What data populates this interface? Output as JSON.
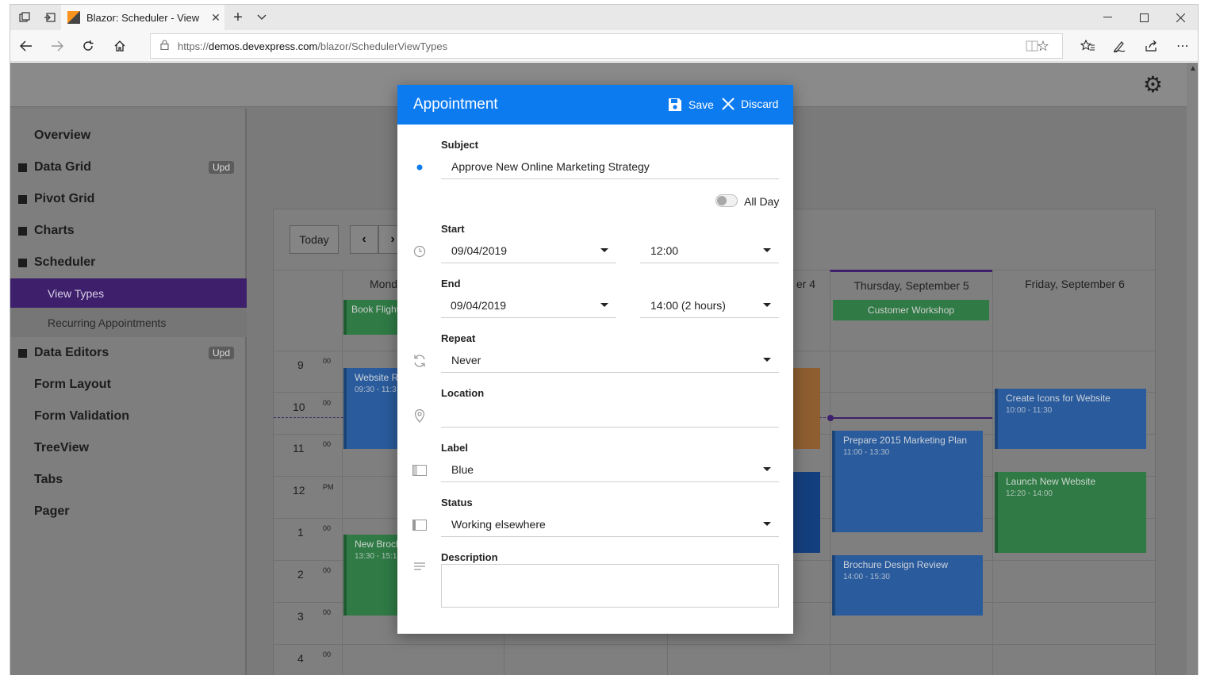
{
  "browser": {
    "tab_title": "Blazor: Scheduler - View",
    "url_prefix": "https://",
    "url_host": "demos.devexpress.com",
    "url_path": "/blazor/SchedulerViewTypes"
  },
  "sidebar": {
    "items": [
      {
        "label": "Overview",
        "bullet": false,
        "badge": ""
      },
      {
        "label": "Data Grid",
        "bullet": true,
        "badge": "Upd"
      },
      {
        "label": "Pivot Grid",
        "bullet": true,
        "badge": ""
      },
      {
        "label": "Charts",
        "bullet": true,
        "badge": ""
      },
      {
        "label": "Scheduler",
        "bullet": true,
        "badge": ""
      }
    ],
    "subitems": [
      {
        "label": "View Types",
        "active": true
      },
      {
        "label": "Recurring Appointments",
        "active": false
      }
    ],
    "items_after": [
      {
        "label": "Data Editors",
        "bullet": true,
        "badge": "Upd"
      },
      {
        "label": "Form Layout",
        "bullet": false,
        "badge": ""
      },
      {
        "label": "Form Validation",
        "bullet": false,
        "badge": ""
      },
      {
        "label": "TreeView",
        "bullet": false,
        "badge": ""
      },
      {
        "label": "Tabs",
        "bullet": false,
        "badge": ""
      },
      {
        "label": "Pager",
        "bullet": false,
        "badge": ""
      }
    ]
  },
  "scheduler": {
    "today_label": "Today",
    "days": [
      "Mond",
      "er 4",
      "Thursday, September 5",
      "Friday, September 6"
    ],
    "hours": [
      {
        "h": "9",
        "m": "00"
      },
      {
        "h": "10",
        "m": "00"
      },
      {
        "h": "11",
        "m": "00"
      },
      {
        "h": "12",
        "m": "PM"
      },
      {
        "h": "1",
        "m": "00"
      },
      {
        "h": "2",
        "m": "00"
      },
      {
        "h": "3",
        "m": "00"
      },
      {
        "h": "4",
        "m": "00"
      }
    ],
    "allday": {
      "mon": "Book Flight",
      "thu": "Customer Workshop"
    },
    "appointments": {
      "mon1": {
        "title": "Website Re",
        "time": "09:30 - 11:3"
      },
      "mon2": {
        "title": "New Broch",
        "time": "13:30 - 15:1"
      },
      "thu1": {
        "title": "Prepare 2015 Marketing Plan",
        "time": "11:00 - 13:30"
      },
      "thu2": {
        "title": "Brochure Design Review",
        "time": "14:00 - 15:30"
      },
      "fri1": {
        "title": "Create Icons for Website",
        "time": "10:00 - 11:30"
      },
      "fri2": {
        "title": "Launch New Website",
        "time": "12:20 - 14:00"
      }
    }
  },
  "dialog": {
    "title": "Appointment",
    "save_label": "Save",
    "discard_label": "Discard",
    "subject_label": "Subject",
    "subject_value": "Approve New Online Marketing Strategy",
    "allday_label": "All Day",
    "start_label": "Start",
    "start_date": "09/04/2019",
    "start_time": "12:00",
    "end_label": "End",
    "end_date": "09/04/2019",
    "end_time": "14:00 (2 hours)",
    "repeat_label": "Repeat",
    "repeat_value": "Never",
    "location_label": "Location",
    "location_value": "",
    "label_label": "Label",
    "label_value": "Blue",
    "status_label": "Status",
    "status_value": "Working elsewhere",
    "description_label": "Description",
    "description_value": "",
    "accent_color": "#0d7bf0"
  }
}
